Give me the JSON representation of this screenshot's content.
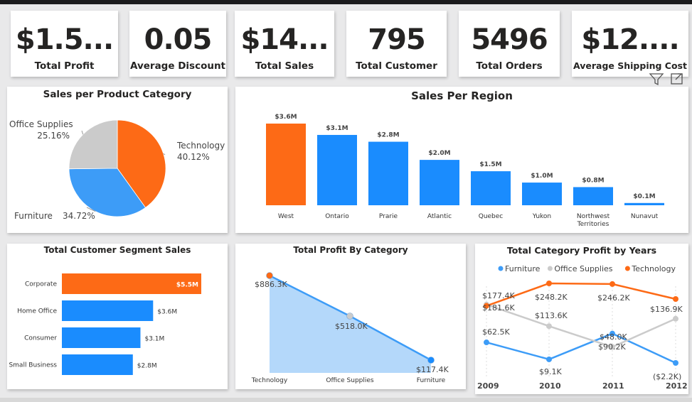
{
  "colors": {
    "orange": "#fd6a16",
    "blue": "#1a8cfe",
    "gray": "#cbcbcb",
    "light_blue": "#3d9cf7",
    "area_fill": "#b4d8fa",
    "text": "#252423"
  },
  "kpis": [
    {
      "value": "$1.5...",
      "label": "Total Profit"
    },
    {
      "value": "0.05",
      "label": "Average Discount"
    },
    {
      "value": "$14...",
      "label": "Total Sales"
    },
    {
      "value": "795",
      "label": "Total Customer"
    },
    {
      "value": "5496",
      "label": "Total Orders"
    },
    {
      "value": "$12....",
      "label": "Average Shipping Cost"
    }
  ],
  "toolbar": {
    "filter_icon": "filter-icon",
    "focus_icon": "focus-mode-icon"
  },
  "chart_data": [
    {
      "id": "product_category",
      "type": "pie",
      "title": "Sales per Product Category",
      "slices": [
        {
          "name": "Technology",
          "value": 40.12,
          "label": "40.12%",
          "color": "#fd6a16"
        },
        {
          "name": "Furniture",
          "value": 34.72,
          "label": "34.72%",
          "color": "#3d9cf7"
        },
        {
          "name": "Office Supplies",
          "value": 25.16,
          "label": "25.16%",
          "color": "#cbcbcb"
        }
      ]
    },
    {
      "id": "region",
      "type": "bar",
      "title": "Sales Per Region",
      "categories": [
        "West",
        "Ontario",
        "Prarie",
        "Atlantic",
        "Quebec",
        "Yukon",
        "Northwest Territories",
        "Nunavut"
      ],
      "category_lines": [
        [
          "West"
        ],
        [
          "Ontario"
        ],
        [
          "Prarie"
        ],
        [
          "Atlantic"
        ],
        [
          "Quebec"
        ],
        [
          "Yukon"
        ],
        [
          "Northwest",
          "Territories"
        ],
        [
          "Nunavut"
        ]
      ],
      "values": [
        3.6,
        3.1,
        2.8,
        2.0,
        1.5,
        1.0,
        0.8,
        0.1
      ],
      "value_labels": [
        "$3.6M",
        "$3.1M",
        "$2.8M",
        "$2.0M",
        "$1.5M",
        "$1.0M",
        "$0.8M",
        "$0.1M"
      ],
      "unit": "$M",
      "highlight_index": 0
    },
    {
      "id": "segment",
      "type": "bar",
      "orientation": "horizontal",
      "title": "Total Customer Segment Sales",
      "categories": [
        "Corporate",
        "Home Office",
        "Consumer",
        "Small Business"
      ],
      "values": [
        5.5,
        3.6,
        3.1,
        2.8
      ],
      "value_labels": [
        "$5.5M",
        "$3.6M",
        "$3.1M",
        "$2.8M"
      ],
      "unit": "$M",
      "highlight_index": 0
    },
    {
      "id": "profit_category",
      "type": "area",
      "title": "Total Profit By Category",
      "categories": [
        "Technology",
        "Office Supplies",
        "Furniture"
      ],
      "values": [
        886.3,
        518.0,
        117.4
      ],
      "value_labels": [
        "$886.3K",
        "$518.0K",
        "$117.4K"
      ],
      "unit": "$K"
    },
    {
      "id": "category_years",
      "type": "line",
      "title": "Total Category Profit by Years",
      "legend_position": "top",
      "x": [
        "2009",
        "2010",
        "2011",
        "2012"
      ],
      "series": [
        {
          "name": "Furniture",
          "color": "#3d9cf7",
          "values": [
            62.5,
            9.1,
            90.2,
            -2.2
          ],
          "labels": [
            "$62.5K",
            "$9.1K",
            "$90.2K",
            "($2.2K)"
          ]
        },
        {
          "name": "Office Supplies",
          "color": "#cbcbcb",
          "values": [
            181.6,
            113.6,
            48.0,
            136.9
          ],
          "labels": [
            "$181.6K",
            "$113.6K",
            "$48.0K",
            "$136.9K"
          ]
        },
        {
          "name": "Technology",
          "color": "#fd6a16",
          "values": [
            177.4,
            248.2,
            246.2,
            199.0
          ],
          "labels": [
            "$177.4K",
            "$248.2K",
            "$246.2K",
            ""
          ]
        }
      ]
    }
  ]
}
